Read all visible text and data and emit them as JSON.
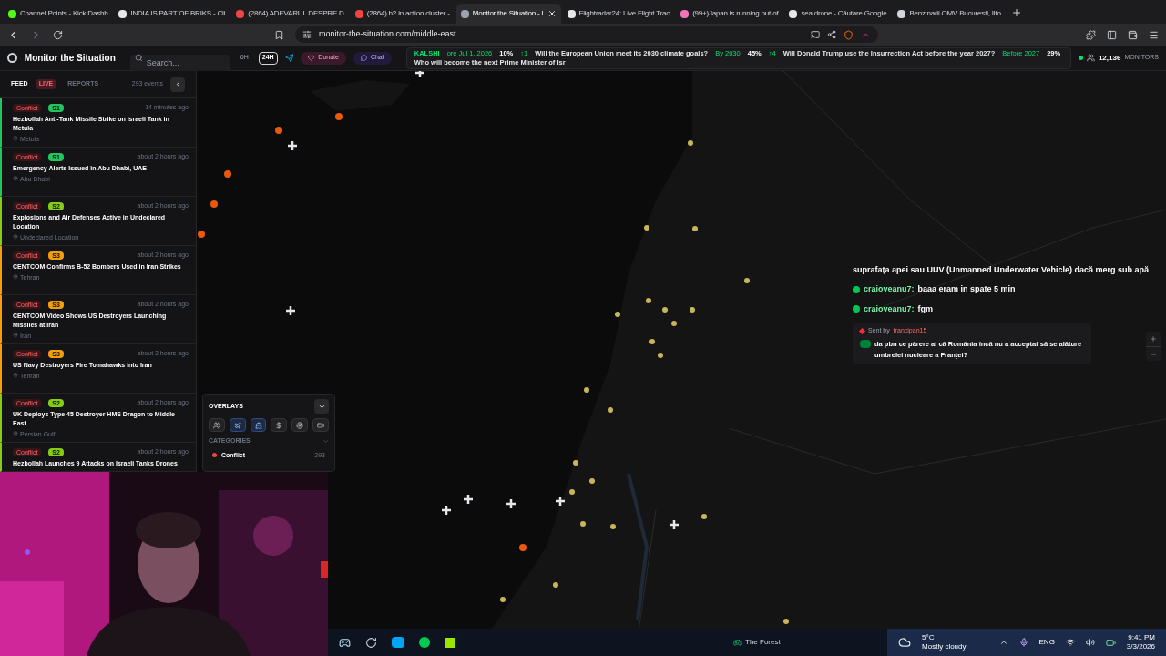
{
  "browser": {
    "tabs": [
      {
        "title": "Channel Points - Kick Dashb",
        "selected": false,
        "color": "#53fc18"
      },
      {
        "title": "INDIA IS PART OF BRIKS - Cli",
        "selected": false,
        "color": "#e5e7eb"
      },
      {
        "title": "(2864) ADEVARUL DESPRE D",
        "selected": false,
        "color": "#ef4444"
      },
      {
        "title": "(2864) b2 in action cluster -",
        "selected": false,
        "color": "#ef4444"
      },
      {
        "title": "Monitor the Situation - I",
        "selected": true,
        "color": "#9ca3af"
      },
      {
        "title": "Flightradar24: Live Flight Trac",
        "selected": false,
        "color": "#e5e7eb"
      },
      {
        "title": "(99+)Japan is running out of",
        "selected": false,
        "color": "#f472b6"
      },
      {
        "title": "sea drone - Căutare Google",
        "selected": false,
        "color": "#e5e7eb"
      },
      {
        "title": "Benzinarii OMV Bucuresti, Ilfo",
        "selected": false,
        "color": "#d1d5db"
      }
    ],
    "url": "monitor-the-situation.com/middle-east"
  },
  "app": {
    "title": "Monitor the Situation",
    "search": {
      "placeholder": "Search..."
    },
    "ranges": [
      {
        "label": "6H",
        "selected": false
      },
      {
        "label": "24H",
        "selected": true
      }
    ],
    "donate": "Donate",
    "chat": "Chat",
    "ticker": {
      "source": "KALSHI",
      "items": [
        {
          "outcome": "ore Jul 1, 2026",
          "percent": "10%",
          "change": "↑1"
        },
        {
          "question": "Will the European Union meet its 2030 climate goals?",
          "outcome": "By 2030",
          "percent": "45%",
          "change": "↑4"
        },
        {
          "question": "Will Donald Trump use the Insurrection Act before the year 2027?",
          "outcome": "Before 2027",
          "percent": "29%"
        },
        {
          "question": "Who will become the next Prime Minister of Isr"
        }
      ]
    },
    "monitors": {
      "count": "12,136",
      "label": "MONITORS"
    }
  },
  "feed": {
    "title": "FEED",
    "tabs": [
      {
        "label": "LIVE",
        "selected": true
      },
      {
        "label": "REPORTS",
        "selected": false
      }
    ],
    "count": "293 events",
    "events": [
      {
        "category": "Conflict",
        "severity": "S1",
        "color": "#22c55e",
        "time": "14 minutes ago",
        "title": "Hezbollah Anti-Tank Missile Strike on Israeli Tank in Metula",
        "location": "Metula"
      },
      {
        "category": "Conflict",
        "severity": "S1",
        "color": "#22c55e",
        "time": "about 2 hours ago",
        "title": "Emergency Alerts Issued in Abu Dhabi, UAE",
        "location": "Abu Dhabi"
      },
      {
        "category": "Conflict",
        "severity": "S2",
        "color": "#84cc16",
        "time": "about 2 hours ago",
        "title": "Explosions and Air Defenses Active in Undeclared Location",
        "location": "Undeclared Location"
      },
      {
        "category": "Conflict",
        "severity": "S3",
        "color": "#f59e0b",
        "time": "about 2 hours ago",
        "title": "CENTCOM Confirms B-52 Bombers Used in Iran Strikes",
        "location": "Tehran"
      },
      {
        "category": "Conflict",
        "severity": "S3",
        "color": "#f59e0b",
        "time": "about 2 hours ago",
        "title": "CENTCOM Video Shows US Destroyers Launching Missiles at Iran",
        "location": "Iran"
      },
      {
        "category": "Conflict",
        "severity": "S3",
        "color": "#f59e0b",
        "time": "about 2 hours ago",
        "title": "US Navy Destroyers Fire Tomahawks into Iran",
        "location": "Tehran"
      },
      {
        "category": "Conflict",
        "severity": "S2",
        "color": "#84cc16",
        "time": "about 2 hours ago",
        "title": "UK Deploys Type 45 Destroyer HMS Dragon to Middle East",
        "location": "Persian Gulf"
      },
      {
        "category": "Conflict",
        "severity": "S2",
        "color": "#84cc16",
        "time": "about 2 hours ago",
        "title": "Hezbollah Launches 9 Attacks on Israeli Tanks Drones"
      }
    ]
  },
  "overlays": {
    "title": "OVERLAYS",
    "buttons": [
      {
        "kind": "people",
        "selected": false
      },
      {
        "kind": "plane",
        "selected": true
      },
      {
        "kind": "ship",
        "selected": true
      },
      {
        "kind": "dollar",
        "selected": false
      },
      {
        "kind": "radar",
        "selected": false
      },
      {
        "kind": "camera",
        "selected": false
      }
    ],
    "categories_title": "CATEGORIES",
    "categories": [
      {
        "name": "Conflict",
        "count": "293",
        "color": "#ef4444"
      }
    ]
  },
  "chat": {
    "messages": [
      {
        "kind": "text",
        "text": "suprafața apei sau UUV (Unmanned Underwater Vehicle) dacă merg sub apă"
      },
      {
        "kind": "user",
        "user": "craioveanu7:",
        "text": "baaa eram in spate 5 min"
      },
      {
        "kind": "user",
        "user": "craioveanu7:",
        "text": "fgm"
      }
    ],
    "highlight": {
      "sent_by": "Sent by",
      "user": "francipan15",
      "text": "da pbn ce părere ai că România încă nu a acceptat să se alăture umbrelei nucleare a Franței?"
    }
  },
  "taskbar": {
    "app": "The Forest",
    "temperature": "5°C",
    "weather": "Mostly cloudy",
    "language": "ENG",
    "time": "9:41 PM",
    "date": "3/3/2026"
  }
}
